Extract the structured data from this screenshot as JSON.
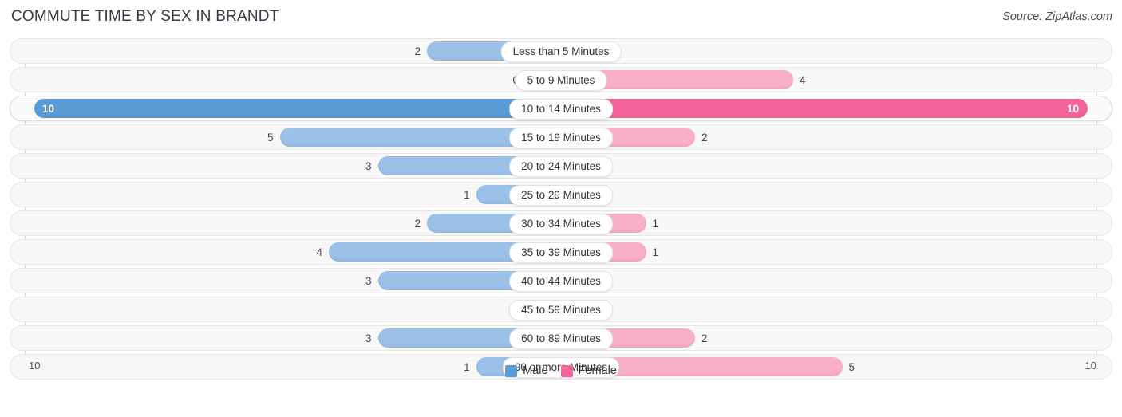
{
  "title": "COMMUTE TIME BY SEX IN BRANDT",
  "source": "Source: ZipAtlas.com",
  "colors": {
    "male": "#9BC1E8",
    "female": "#F9AFC8",
    "male_highlight": "#5B9BD5",
    "female_highlight": "#F4639A"
  },
  "axis": {
    "left": "10",
    "right": "10"
  },
  "legend": [
    {
      "label": "Male",
      "color": "#5B9BD5"
    },
    {
      "label": "Female",
      "color": "#F4639A"
    }
  ],
  "chart_data": {
    "type": "bar",
    "title": "COMMUTE TIME BY SEX IN BRANDT",
    "xlabel": "",
    "ylabel": "",
    "orientation": "horizontal-diverging",
    "axis_max": 10,
    "xlim": [
      10,
      10
    ],
    "grid": true,
    "legend_position": "bottom-center",
    "categories": [
      "Less than 5 Minutes",
      "5 to 9 Minutes",
      "10 to 14 Minutes",
      "15 to 19 Minutes",
      "20 to 24 Minutes",
      "25 to 29 Minutes",
      "30 to 34 Minutes",
      "35 to 39 Minutes",
      "40 to 44 Minutes",
      "45 to 59 Minutes",
      "60 to 89 Minutes",
      "90 or more Minutes"
    ],
    "series": [
      {
        "name": "Male",
        "values": [
          2,
          0,
          10,
          5,
          3,
          1,
          2,
          4,
          3,
          0,
          3,
          1
        ]
      },
      {
        "name": "Female",
        "values": [
          0,
          4,
          10,
          2,
          0,
          0,
          1,
          1,
          0,
          0,
          2,
          5
        ]
      }
    ],
    "highlighted_category": "10 to 14 Minutes"
  },
  "rows": [
    {
      "label": "Less than 5 Minutes",
      "male": "2",
      "female": "0",
      "highlight": false
    },
    {
      "label": "5 to 9 Minutes",
      "male": "0",
      "female": "4",
      "highlight": false
    },
    {
      "label": "10 to 14 Minutes",
      "male": "10",
      "female": "10",
      "highlight": true
    },
    {
      "label": "15 to 19 Minutes",
      "male": "5",
      "female": "2",
      "highlight": false
    },
    {
      "label": "20 to 24 Minutes",
      "male": "3",
      "female": "0",
      "highlight": false
    },
    {
      "label": "25 to 29 Minutes",
      "male": "1",
      "female": "0",
      "highlight": false
    },
    {
      "label": "30 to 34 Minutes",
      "male": "2",
      "female": "1",
      "highlight": false
    },
    {
      "label": "35 to 39 Minutes",
      "male": "4",
      "female": "1",
      "highlight": false
    },
    {
      "label": "40 to 44 Minutes",
      "male": "3",
      "female": "0",
      "highlight": false
    },
    {
      "label": "45 to 59 Minutes",
      "male": "0",
      "female": "0",
      "highlight": false
    },
    {
      "label": "60 to 89 Minutes",
      "male": "3",
      "female": "2",
      "highlight": false
    },
    {
      "label": "90 or more Minutes",
      "male": "1",
      "female": "5",
      "highlight": false
    }
  ]
}
